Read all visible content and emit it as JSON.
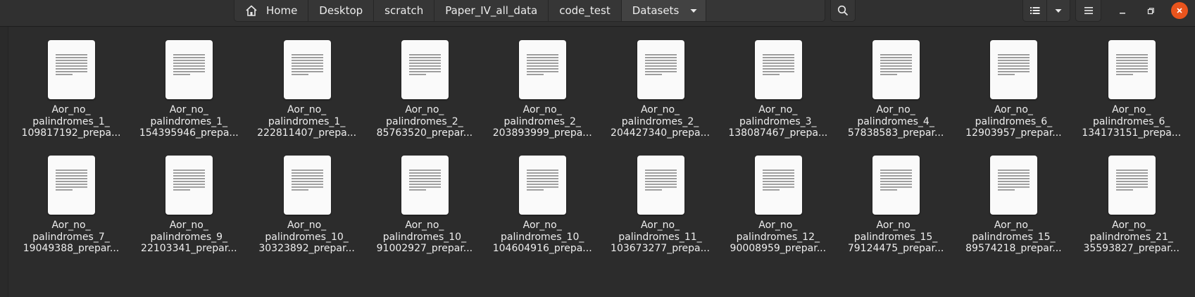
{
  "breadcrumbs": [
    "Home",
    "Desktop",
    "scratch",
    "Paper_IV_all_data",
    "code_test",
    "Datasets"
  ],
  "icons": {
    "home": "home-icon",
    "dropdown": "chevron-down-icon",
    "search": "search-icon",
    "list_view": "list-view-icon",
    "menu": "hamburger-menu-icon",
    "minimize": "minimize-icon",
    "maximize": "maximize-icon",
    "close": "close-icon",
    "file": "text-file-icon"
  },
  "colors": {
    "close_button": "#e9541d",
    "background": "#2c2c2c"
  },
  "files": [
    {
      "line1": "Aor_no_",
      "line2": "palindromes_1_",
      "line3": "109817192_prepa..."
    },
    {
      "line1": "Aor_no_",
      "line2": "palindromes_1_",
      "line3": "154395946_prepa..."
    },
    {
      "line1": "Aor_no_",
      "line2": "palindromes_1_",
      "line3": "222811407_prepa..."
    },
    {
      "line1": "Aor_no_",
      "line2": "palindromes_2_",
      "line3": "85763520_prepar..."
    },
    {
      "line1": "Aor_no_",
      "line2": "palindromes_2_",
      "line3": "203893999_prepa..."
    },
    {
      "line1": "Aor_no_",
      "line2": "palindromes_2_",
      "line3": "204427340_prepa..."
    },
    {
      "line1": "Aor_no_",
      "line2": "palindromes_3_",
      "line3": "138087467_prepa..."
    },
    {
      "line1": "Aor_no_",
      "line2": "palindromes_4_",
      "line3": "57838583_prepar..."
    },
    {
      "line1": "Aor_no_",
      "line2": "palindromes_6_",
      "line3": "12903957_prepar..."
    },
    {
      "line1": "Aor_no_",
      "line2": "palindromes_6_",
      "line3": "134173151_prepa..."
    },
    {
      "line1": "Aor_no_",
      "line2": "palindromes_7_",
      "line3": "19049388_prepar..."
    },
    {
      "line1": "Aor_no_",
      "line2": "palindromes_9_",
      "line3": "22103341_prepar..."
    },
    {
      "line1": "Aor_no_",
      "line2": "palindromes_10_",
      "line3": "30323892_prepar..."
    },
    {
      "line1": "Aor_no_",
      "line2": "palindromes_10_",
      "line3": "91002927_prepar..."
    },
    {
      "line1": "Aor_no_",
      "line2": "palindromes_10_",
      "line3": "104604916_prepa..."
    },
    {
      "line1": "Aor_no_",
      "line2": "palindromes_11_",
      "line3": "103673277_prepa..."
    },
    {
      "line1": "Aor_no_",
      "line2": "palindromes_12_",
      "line3": "90008959_prepar..."
    },
    {
      "line1": "Aor_no_",
      "line2": "palindromes_15_",
      "line3": "79124475_prepar..."
    },
    {
      "line1": "Aor_no_",
      "line2": "palindromes_15_",
      "line3": "89574218_prepar..."
    },
    {
      "line1": "Aor_no_",
      "line2": "palindromes_21_",
      "line3": "35593827_prepar..."
    }
  ]
}
